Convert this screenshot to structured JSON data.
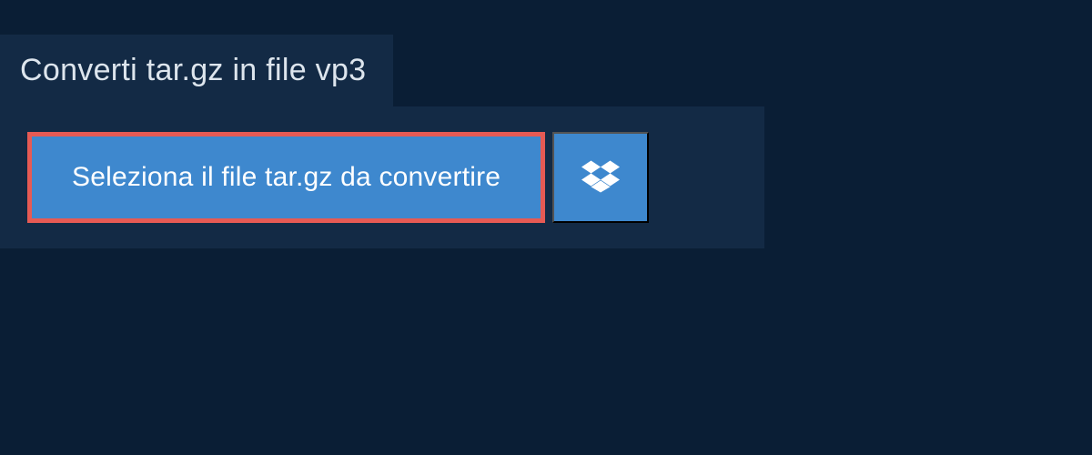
{
  "header": {
    "title": "Converti tar.gz in file vp3"
  },
  "actions": {
    "select_file_label": "Seleziona il file tar.gz da convertire"
  }
}
